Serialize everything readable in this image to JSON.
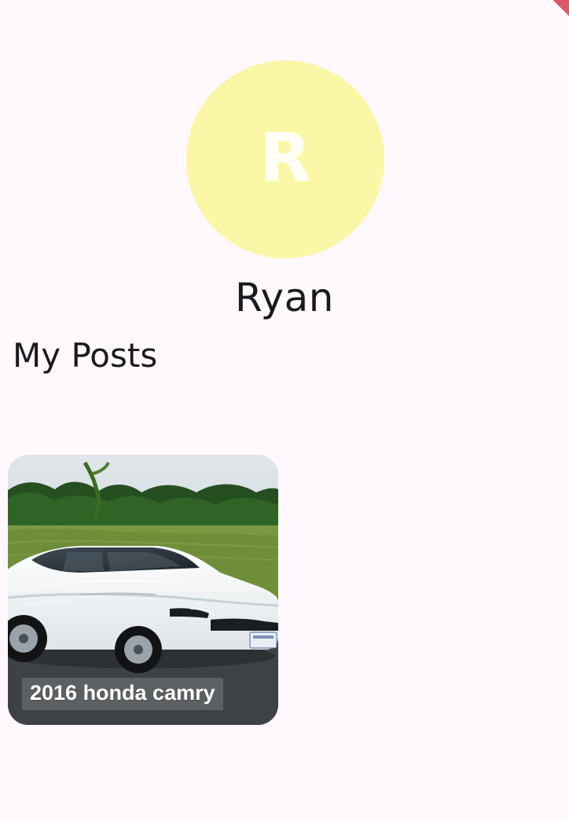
{
  "colors": {
    "background": "#fff8fc",
    "avatar_fill": "#faf7a6",
    "avatar_text": "#fffef4",
    "text_primary": "#1b1b1f",
    "corner_ribbon": "#d8505f"
  },
  "profile": {
    "avatar_initial": "R",
    "name": "Ryan"
  },
  "section": {
    "title": "My Posts"
  },
  "posts": [
    {
      "title": "2016 honda camry",
      "image_icon": "car-photo"
    }
  ]
}
